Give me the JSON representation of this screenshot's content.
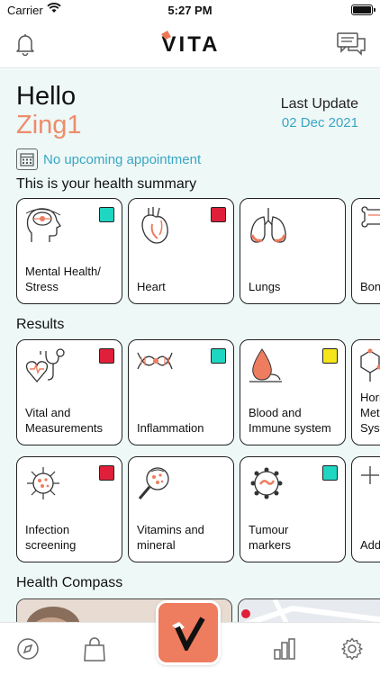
{
  "status_bar": {
    "carrier": "Carrier",
    "time": "5:27 PM"
  },
  "header": {
    "logo_text": "VITA"
  },
  "greeting": {
    "hello": "Hello",
    "username": "Zing1"
  },
  "last_update": {
    "label": "Last Update",
    "date": "02 Dec 2021"
  },
  "appointment": {
    "text": "No upcoming appointment"
  },
  "health_summary": {
    "title": "This is your health summary",
    "cards": [
      {
        "label": "Mental Health/\nStress",
        "icon": "brain-head-icon",
        "status_color": "#1fd6c3"
      },
      {
        "label": "Heart",
        "icon": "heart-icon",
        "status_color": "#e0203a"
      },
      {
        "label": "Lungs",
        "icon": "lungs-icon",
        "status_color": ""
      },
      {
        "label": "Bon",
        "icon": "bone-icon",
        "status_color": ""
      }
    ]
  },
  "results": {
    "title": "Results",
    "cards": [
      {
        "label": "Vital and\nMeasurements",
        "icon": "stethoscope-heart-icon",
        "status_color": "#e0203a"
      },
      {
        "label": "Inflammation",
        "icon": "dna-icon",
        "status_color": "#1fd6c3"
      },
      {
        "label": "Blood and\nImmune system",
        "icon": "blood-drop-icon",
        "status_color": "#f7e51c"
      },
      {
        "label": "Horm\nMet\nSyst",
        "icon": "molecule-icon",
        "status_color": ""
      },
      {
        "label": "Infection\nscreening",
        "icon": "virus-icon",
        "status_color": "#e0203a"
      },
      {
        "label": "Vitamins and\nmineral",
        "icon": "magnifier-icon",
        "status_color": ""
      },
      {
        "label": "Tumour\nmarkers",
        "icon": "cell-icon",
        "status_color": "#1fd6c3"
      },
      {
        "label": "Add",
        "icon": "plus-icon",
        "status_color": ""
      }
    ]
  },
  "health_compass": {
    "title": "Health Compass"
  },
  "tab_bar": {
    "items": [
      "compass-icon",
      "shopping-bag-icon",
      "vita-home-icon",
      "bar-chart-icon",
      "settings-gear-icon"
    ]
  },
  "colors": {
    "accent": "#ee7c5e",
    "link": "#3aa6c4",
    "background": "#eef8f7"
  }
}
